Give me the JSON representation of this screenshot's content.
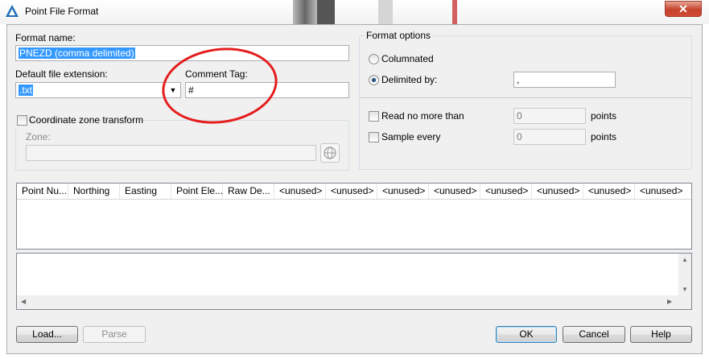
{
  "window": {
    "title": "Point File Format",
    "close_glyph": "✕"
  },
  "format_name": {
    "label": "Format name:",
    "value": "PNEZD (comma delimited)"
  },
  "default_ext": {
    "label": "Default file extension:",
    "value": ".txt"
  },
  "comment_tag": {
    "label": "Comment Tag:",
    "value": "#"
  },
  "coord_zone": {
    "label": "Coordinate zone transform",
    "checked": false,
    "zone_label": "Zone:",
    "zone_value": ""
  },
  "format_options": {
    "title": "Format options",
    "columnated": {
      "label": "Columnated",
      "selected": false
    },
    "delimited": {
      "label": "Delimited by:",
      "selected": true,
      "value": ","
    },
    "read_no_more": {
      "label": "Read no more than",
      "value": "0",
      "unit": "points",
      "checked": false
    },
    "sample_every": {
      "label": "Sample every",
      "value": "0",
      "unit": "points",
      "checked": false
    }
  },
  "columns": [
    "Point Nu...",
    "Northing",
    "Easting",
    "Point Ele...",
    "Raw De...",
    "<unused>",
    "<unused>",
    "<unused>",
    "<unused>",
    "<unused>",
    "<unused>",
    "<unused>",
    "<unused>"
  ],
  "buttons": {
    "load": "Load...",
    "parse": "Parse",
    "ok": "OK",
    "cancel": "Cancel",
    "help": "Help"
  },
  "colors": {
    "selection": "#3399ff",
    "annotation": "#e51c1c",
    "dialog_bg": "#f0f0f0"
  },
  "icons": [
    "app-logo-icon",
    "close-icon",
    "dropdown-arrow-icon",
    "globe-icon",
    "scroll-up-icon",
    "scroll-down-icon",
    "scroll-left-icon",
    "scroll-right-icon"
  ]
}
